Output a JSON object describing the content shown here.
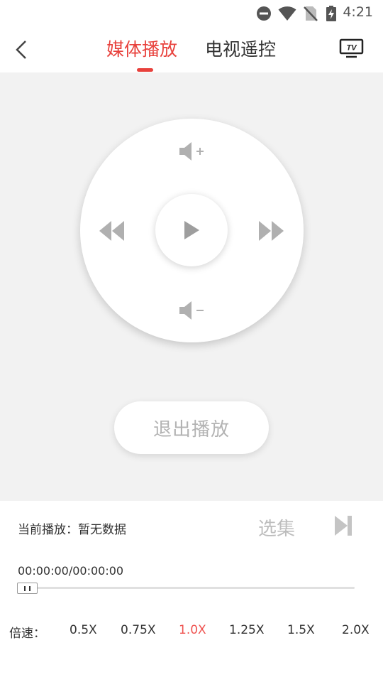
{
  "status_bar": {
    "time": "4:21",
    "icons": [
      "do-not-disturb-icon",
      "wifi-icon",
      "no-sim-icon",
      "battery-charging-icon"
    ]
  },
  "header": {
    "tabs": [
      {
        "label": "媒体播放",
        "active": true
      },
      {
        "label": "电视遥控",
        "active": false
      }
    ],
    "tv_icon_text": "TV",
    "accent_color": "#e8413c"
  },
  "remote": {
    "controls": [
      "volume-up-icon",
      "rewind-icon",
      "play-icon",
      "fast-forward-icon",
      "volume-down-icon"
    ],
    "exit_label": "退出播放"
  },
  "player": {
    "now_playing": "当前播放：暂无数据",
    "episodes_label": "选集",
    "time": "00:00:00/00:00:00",
    "progress": 0
  },
  "speed": {
    "label": "倍速：",
    "options": [
      "0.5X",
      "0.75X",
      "1.0X",
      "1.25X",
      "1.5X",
      "2.0X"
    ],
    "selected": "1.0X",
    "selected_color": "#ef5350"
  }
}
